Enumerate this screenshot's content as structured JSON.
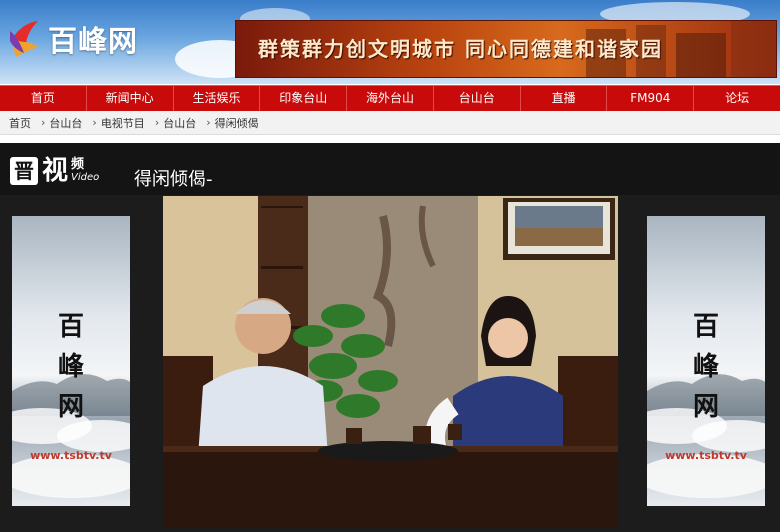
{
  "site": {
    "logo_text": "百峰网",
    "banner_text": "群策群力创文明城市 同心同德建和谐家园"
  },
  "nav": [
    {
      "label": "首页"
    },
    {
      "label": "新闻中心"
    },
    {
      "label": "生活娱乐"
    },
    {
      "label": "印象台山"
    },
    {
      "label": "海外台山"
    },
    {
      "label": "台山台"
    },
    {
      "label": "直播"
    },
    {
      "label": "FM904"
    },
    {
      "label": "论坛"
    }
  ],
  "breadcrumb": [
    {
      "label": "首页"
    },
    {
      "label": "台山台"
    },
    {
      "label": "电视节目"
    },
    {
      "label": "台山台"
    },
    {
      "label": "得闲倾偈"
    }
  ],
  "video_section": {
    "logo_box": "晋",
    "logo_cn": "视",
    "logo_small_cn": "频",
    "logo_small_en": "Video",
    "title": "得闲倾偈-"
  },
  "side_ads": {
    "chars": [
      "百",
      "峰",
      "网"
    ],
    "url": "www.tsbtv.tv"
  }
}
